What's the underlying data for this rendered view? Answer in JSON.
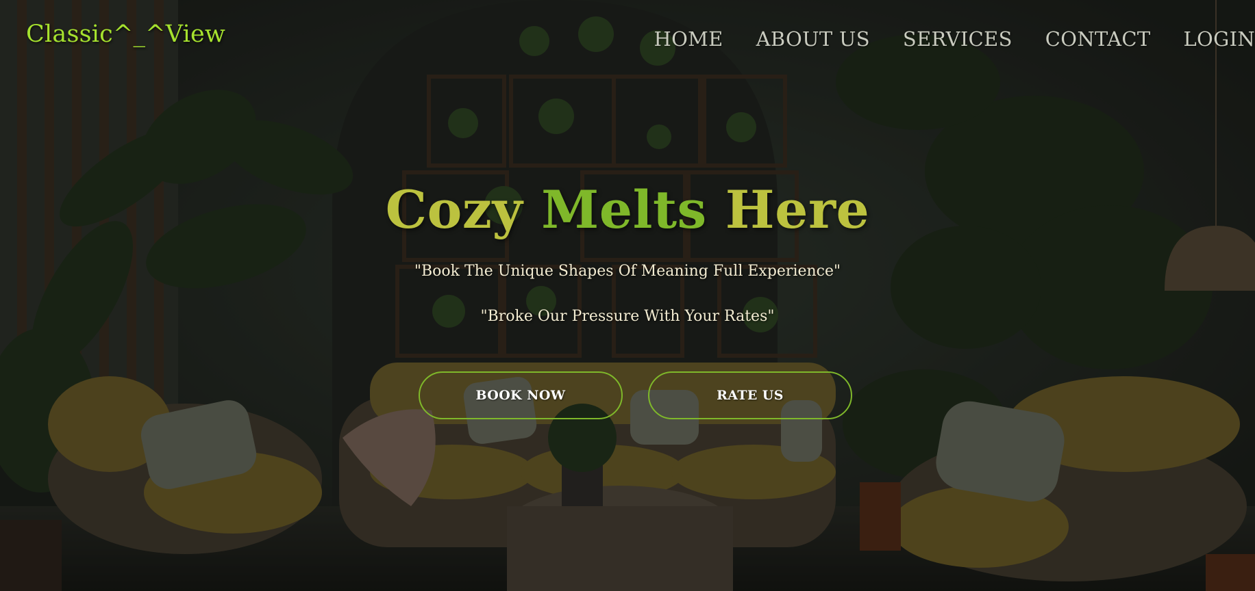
{
  "header": {
    "logo": "Classic^_^View",
    "nav": [
      {
        "label": "HOME"
      },
      {
        "label": "ABOUT US"
      },
      {
        "label": "SERVICES"
      },
      {
        "label": "CONTACT"
      },
      {
        "label": "LOGIN"
      }
    ]
  },
  "hero": {
    "title_part1": "Cozy ",
    "title_accent": "Melts",
    "title_part2": " Here",
    "tagline1": "\"Book The Unique Shapes Of Meaning Full Experience\"",
    "tagline2": "\"Broke Our Pressure With Your Rates\"",
    "book_button": "BOOK NOW",
    "rate_button": "RATE US"
  },
  "colors": {
    "logo": "#a6e22e",
    "title": "#bcc23f",
    "title_accent": "#7fb82a",
    "button_border": "#7fb82a",
    "overlay": "#000000"
  }
}
